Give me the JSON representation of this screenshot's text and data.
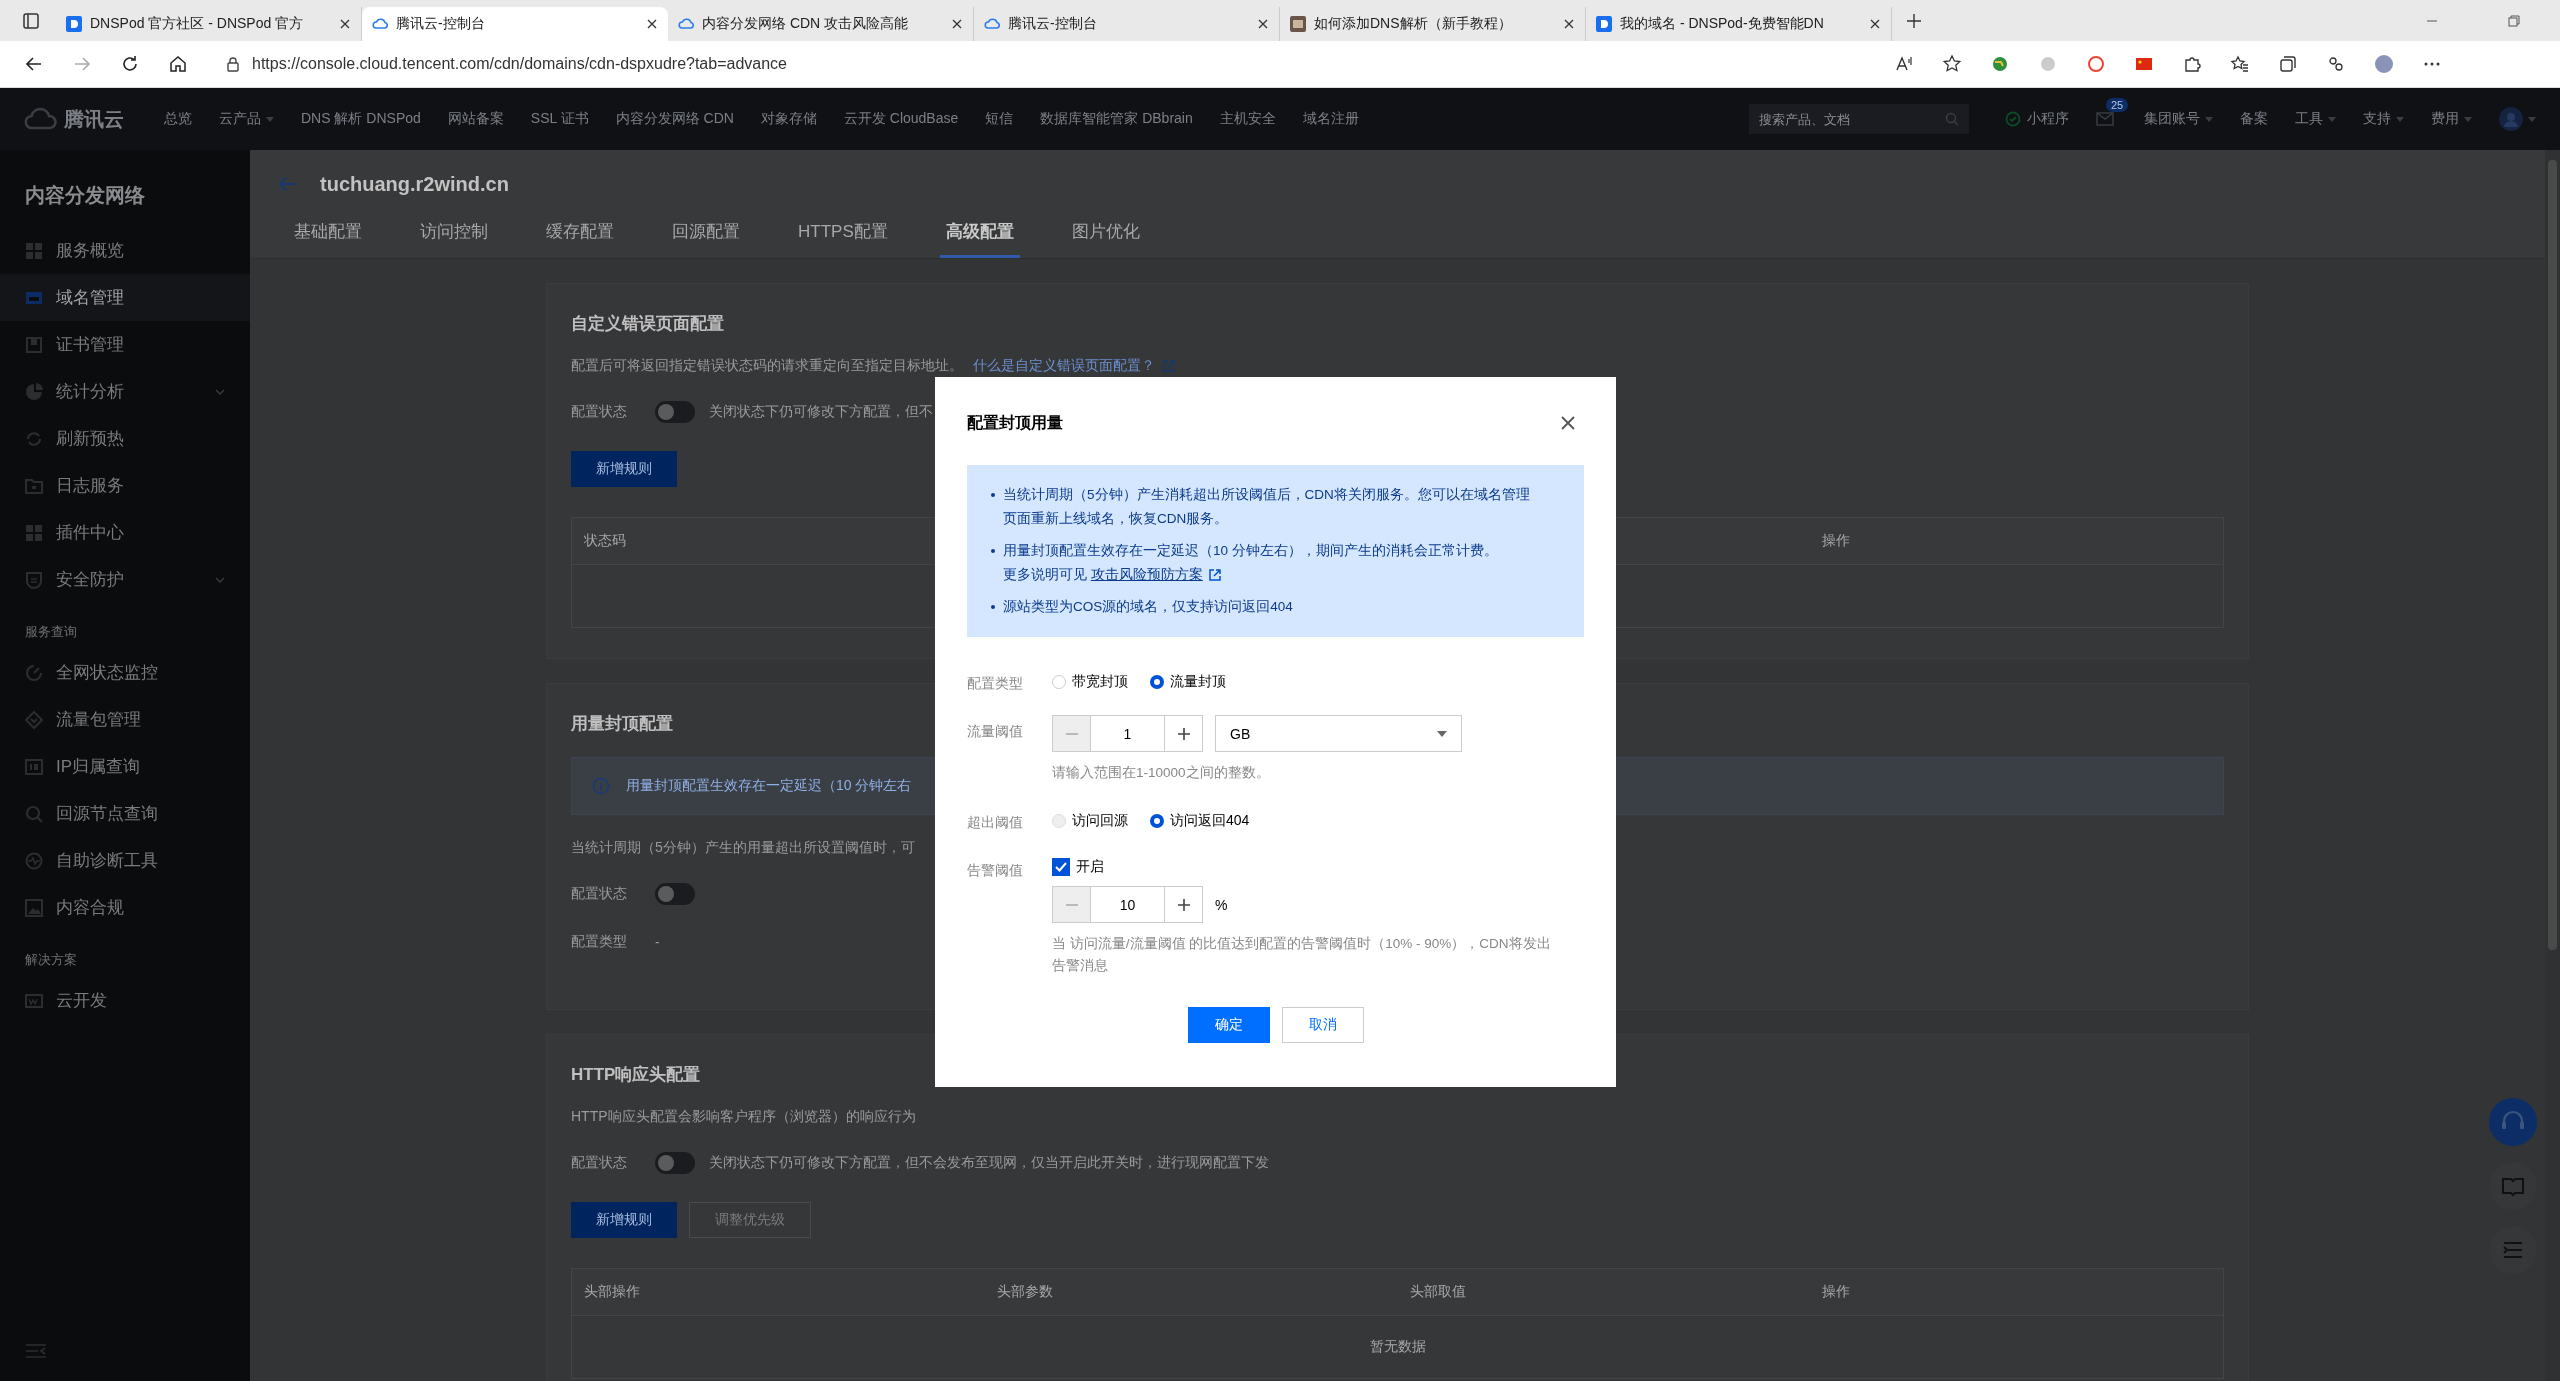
{
  "browser": {
    "tabs": [
      {
        "title": "DNSPod 官方社区 - DNSPod 官方",
        "selected": false
      },
      {
        "title": "腾讯云-控制台",
        "selected": true
      },
      {
        "title": "内容分发网络 CDN 攻击风险高能",
        "selected": false
      },
      {
        "title": "腾讯云-控制台",
        "selected": false
      },
      {
        "title": "如何添加DNS解析（新手教程）",
        "selected": false
      },
      {
        "title": "我的域名 - DNSPod-免费智能DN",
        "selected": false
      }
    ],
    "url": "https://console.cloud.tencent.com/cdn/domains/cdn-dspxudre?tab=advance"
  },
  "topnav": {
    "logo": "腾讯云",
    "items": [
      {
        "label": "总览",
        "dropdown": false
      },
      {
        "label": "云产品",
        "dropdown": true
      },
      {
        "label": "DNS 解析 DNSPod",
        "dropdown": false
      },
      {
        "label": "网站备案",
        "dropdown": false
      },
      {
        "label": "SSL 证书",
        "dropdown": false
      },
      {
        "label": "内容分发网络 CDN",
        "dropdown": false
      },
      {
        "label": "对象存储",
        "dropdown": false
      },
      {
        "label": "云开发 CloudBase",
        "dropdown": false
      },
      {
        "label": "短信",
        "dropdown": false
      },
      {
        "label": "数据库智能管家 DBbrain",
        "dropdown": false
      },
      {
        "label": "主机安全",
        "dropdown": false
      },
      {
        "label": "域名注册",
        "dropdown": false
      }
    ],
    "search": {
      "placeholder": "搜索产品、文档"
    },
    "right": [
      {
        "kind": "mini",
        "label": "小程序"
      },
      {
        "kind": "mail",
        "badge": "25"
      },
      {
        "kind": "menu",
        "label": "集团账号",
        "dropdown": true
      },
      {
        "kind": "menu",
        "label": "备案",
        "dropdown": false
      },
      {
        "kind": "menu",
        "label": "工具",
        "dropdown": true
      },
      {
        "kind": "menu",
        "label": "支持",
        "dropdown": true
      },
      {
        "kind": "menu",
        "label": "费用",
        "dropdown": true
      },
      {
        "kind": "avatar",
        "dropdown": true
      }
    ]
  },
  "sidebar": {
    "title": "内容分发网络",
    "sections": [
      {
        "items": [
          {
            "label": "服务概览",
            "selected": false,
            "expandable": false
          },
          {
            "label": "域名管理",
            "selected": true,
            "expandable": false
          },
          {
            "label": "证书管理",
            "selected": false,
            "expandable": false
          },
          {
            "label": "统计分析",
            "selected": false,
            "expandable": true
          },
          {
            "label": "刷新预热",
            "selected": false,
            "expandable": false
          },
          {
            "label": "日志服务",
            "selected": false,
            "expandable": false
          },
          {
            "label": "插件中心",
            "selected": false,
            "expandable": false
          },
          {
            "label": "安全防护",
            "selected": false,
            "expandable": true
          }
        ]
      },
      {
        "heading": "服务查询",
        "items": [
          {
            "label": "全网状态监控",
            "selected": false,
            "expandable": false
          },
          {
            "label": "流量包管理",
            "selected": false,
            "expandable": false
          },
          {
            "label": "IP归属查询",
            "selected": false,
            "expandable": false
          },
          {
            "label": "回源节点查询",
            "selected": false,
            "expandable": false
          },
          {
            "label": "自助诊断工具",
            "selected": false,
            "expandable": false
          },
          {
            "label": "内容合规",
            "selected": false,
            "expandable": false
          }
        ]
      },
      {
        "heading": "解决方案",
        "items": [
          {
            "label": "云开发",
            "selected": false,
            "expandable": false
          }
        ]
      }
    ]
  },
  "page": {
    "title": "tuchuang.r2wind.cn",
    "tabs": [
      {
        "label": "基础配置",
        "selected": false
      },
      {
        "label": "访问控制",
        "selected": false
      },
      {
        "label": "缓存配置",
        "selected": false
      },
      {
        "label": "回源配置",
        "selected": false
      },
      {
        "label": "HTTPS配置",
        "selected": false
      },
      {
        "label": "高级配置",
        "selected": true
      },
      {
        "label": "图片优化",
        "selected": false
      }
    ]
  },
  "cards": [
    {
      "title": "自定义错误页面配置",
      "blocks": [
        {
          "kind": "desc",
          "text": "配置后可将返回指定错误状态码的请求重定向至指定目标地址。",
          "link": "什么是自定义错误页面配置？"
        },
        {
          "kind": "switch",
          "label": "配置状态",
          "on": false,
          "note": "关闭状态下仍可修改下方配置，但不"
        },
        {
          "kind": "buttons",
          "buttons": [
            {
              "label": "新增规则",
              "disabled": false
            }
          ]
        },
        {
          "kind": "table",
          "columns": [
            "状态码",
            "操作"
          ]
        }
      ]
    },
    {
      "title": "用量封顶配置",
      "blocks": [
        {
          "kind": "banner",
          "text": "用量封顶配置生效存在一定延迟（10 分钟左右"
        },
        {
          "kind": "desc",
          "text": "当统计周期（5分钟）产生的用量超出所设置阈值时，可"
        },
        {
          "kind": "switch",
          "label": "配置状态",
          "on": false
        },
        {
          "kind": "field",
          "label": "配置类型",
          "value": "-"
        }
      ]
    },
    {
      "title": "HTTP响应头配置",
      "blocks": [
        {
          "kind": "desc",
          "text": "HTTP响应头配置会影响客户程序（浏览器）的响应行为"
        },
        {
          "kind": "switch",
          "label": "配置状态",
          "on": false,
          "note": "关闭状态下仍可修改下方配置，但不会发布至现网，仅当开启此开关时，进行现网配置下发"
        },
        {
          "kind": "buttons",
          "buttons": [
            {
              "label": "新增规则",
              "disabled": false
            },
            {
              "label": "调整优先级",
              "disabled": true
            }
          ]
        },
        {
          "kind": "table",
          "columns": [
            "头部操作",
            "头部参数",
            "头部取值",
            "操作"
          ],
          "empty": "暂无数据"
        }
      ]
    }
  ],
  "dialog": {
    "title": "配置封顶用量",
    "notices": [
      {
        "text": "当统计周期（5分钟）产生消耗超出所设阈值后，CDN将关闭服务。您可以在域名管理页面重新上线域名，恢复CDN服务。"
      },
      {
        "text": "用量封顶配置生效存在一定延迟（10 分钟左右），期间产生的消耗会正常计费。",
        "more": "更多说明可见",
        "link": "攻击风险预防方案"
      },
      {
        "text": "源站类型为COS源的域名，仅支持访问返回404"
      }
    ],
    "fields": [
      {
        "kind": "radio",
        "label": "配置类型",
        "options": [
          {
            "label": "带宽封顶",
            "selected": false,
            "disabled": false
          },
          {
            "label": "流量封顶",
            "selected": true,
            "disabled": false
          }
        ]
      },
      {
        "kind": "stepper",
        "label": "流量阈值",
        "value": "1",
        "select": "GB",
        "hint": "请输入范围在1-10000之间的整数。"
      },
      {
        "kind": "radio",
        "label": "超出阈值",
        "options": [
          {
            "label": "访问回源",
            "selected": false,
            "disabled": true
          },
          {
            "label": "访问返回404",
            "selected": true,
            "disabled": false
          }
        ]
      },
      {
        "kind": "check",
        "label": "告警阈值",
        "check_label": "开启",
        "checked": true,
        "value": "10",
        "unit": "%",
        "hint": "当 访问流量/流量阈值 的比值达到配置的告警阈值时（10% - 90%），CDN将发出告警消息"
      }
    ],
    "buttons": [
      {
        "label": "确定",
        "kind": "primary"
      },
      {
        "label": "取消",
        "kind": "secondary"
      }
    ]
  }
}
